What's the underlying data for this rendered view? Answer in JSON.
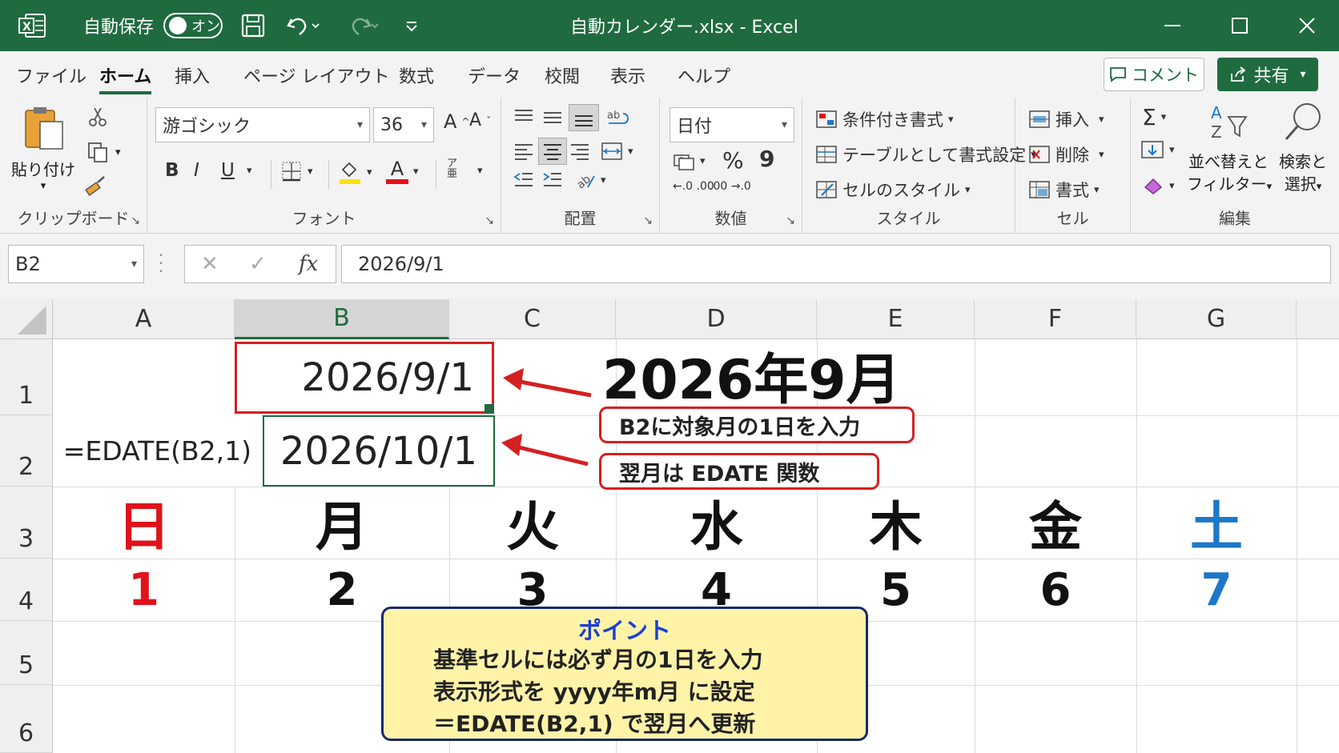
{
  "titlebar": {
    "autosave_label": "自動保存",
    "toggle_label": "オン",
    "title": "自動カレンダー.xlsx  -  Excel",
    "colors": {
      "bar": "#1f6b3f"
    }
  },
  "tabs": [
    "ファイル",
    "ホーム",
    "挿入",
    "ページ レイアウト",
    "数式",
    "データ",
    "校閲",
    "表示",
    "ヘルプ"
  ],
  "active_tab": "ホーム",
  "buttons": {
    "comment": "コメント",
    "share": "共有"
  },
  "ribbon": {
    "clipboard": {
      "paste": "貼り付け",
      "label": "クリップボード"
    },
    "font": {
      "name": "游ゴシック",
      "size": "36",
      "bold": "B",
      "italic": "I",
      "underline": "U",
      "font_color_glyph": "A",
      "grow": "A^",
      "shrink": "Aˇ",
      "label": "フォント"
    },
    "alignment": {
      "label": "配置"
    },
    "number": {
      "format": "日付",
      "percent": "%",
      "comma": "9",
      "label": "数値",
      "inc": "←.0 .00",
      "dec": ".00 →.0"
    },
    "styles": {
      "conditional": "条件付き書式",
      "table": "テーブルとして書式設定",
      "cell_styles": "セルのスタイル",
      "label": "スタイル"
    },
    "cells": {
      "insert": "挿入",
      "delete": "削除",
      "format": "書式",
      "label": "セル"
    },
    "editing": {
      "sort1": "並べ替えと",
      "sort2": "フィルター",
      "find1": "検索と",
      "find2": "選択",
      "sigma": "Σ",
      "label": "編集"
    }
  },
  "formula_bar": {
    "name_box": "B2",
    "fx": "fx",
    "formula": "2026/9/1"
  },
  "sheet": {
    "columns": [
      "A",
      "B",
      "C",
      "D",
      "E",
      "F",
      "G"
    ],
    "rows": [
      "1",
      "2",
      "3",
      "4",
      "5",
      "6"
    ],
    "b1": "2026/9/1",
    "a2": "=EDATE(B2,1)",
    "b2": "2026/10/1",
    "title": "2026年9月",
    "weekdays": [
      "日",
      "月",
      "火",
      "水",
      "木",
      "金",
      "土"
    ],
    "days": [
      "1",
      "2",
      "3",
      "4",
      "5",
      "6",
      "7"
    ],
    "colors": {
      "sunday": "#e0121a",
      "saturday": "#1c78c8",
      "text": "#111111",
      "accent": "#d42020"
    }
  },
  "callouts": {
    "c1": "B2に対象月の1日を入力",
    "c2": "翌月は EDATE 関数"
  },
  "note": {
    "title": "ポイント",
    "line1": "基準セルには必ず月の1日を入力",
    "line2": "表示形式を yyyy年m月 に設定",
    "line3": "＝EDATE(B2,1) で翌月へ更新",
    "colors": {
      "title": "#1a3fd6",
      "bg": "#fff3a8"
    }
  }
}
